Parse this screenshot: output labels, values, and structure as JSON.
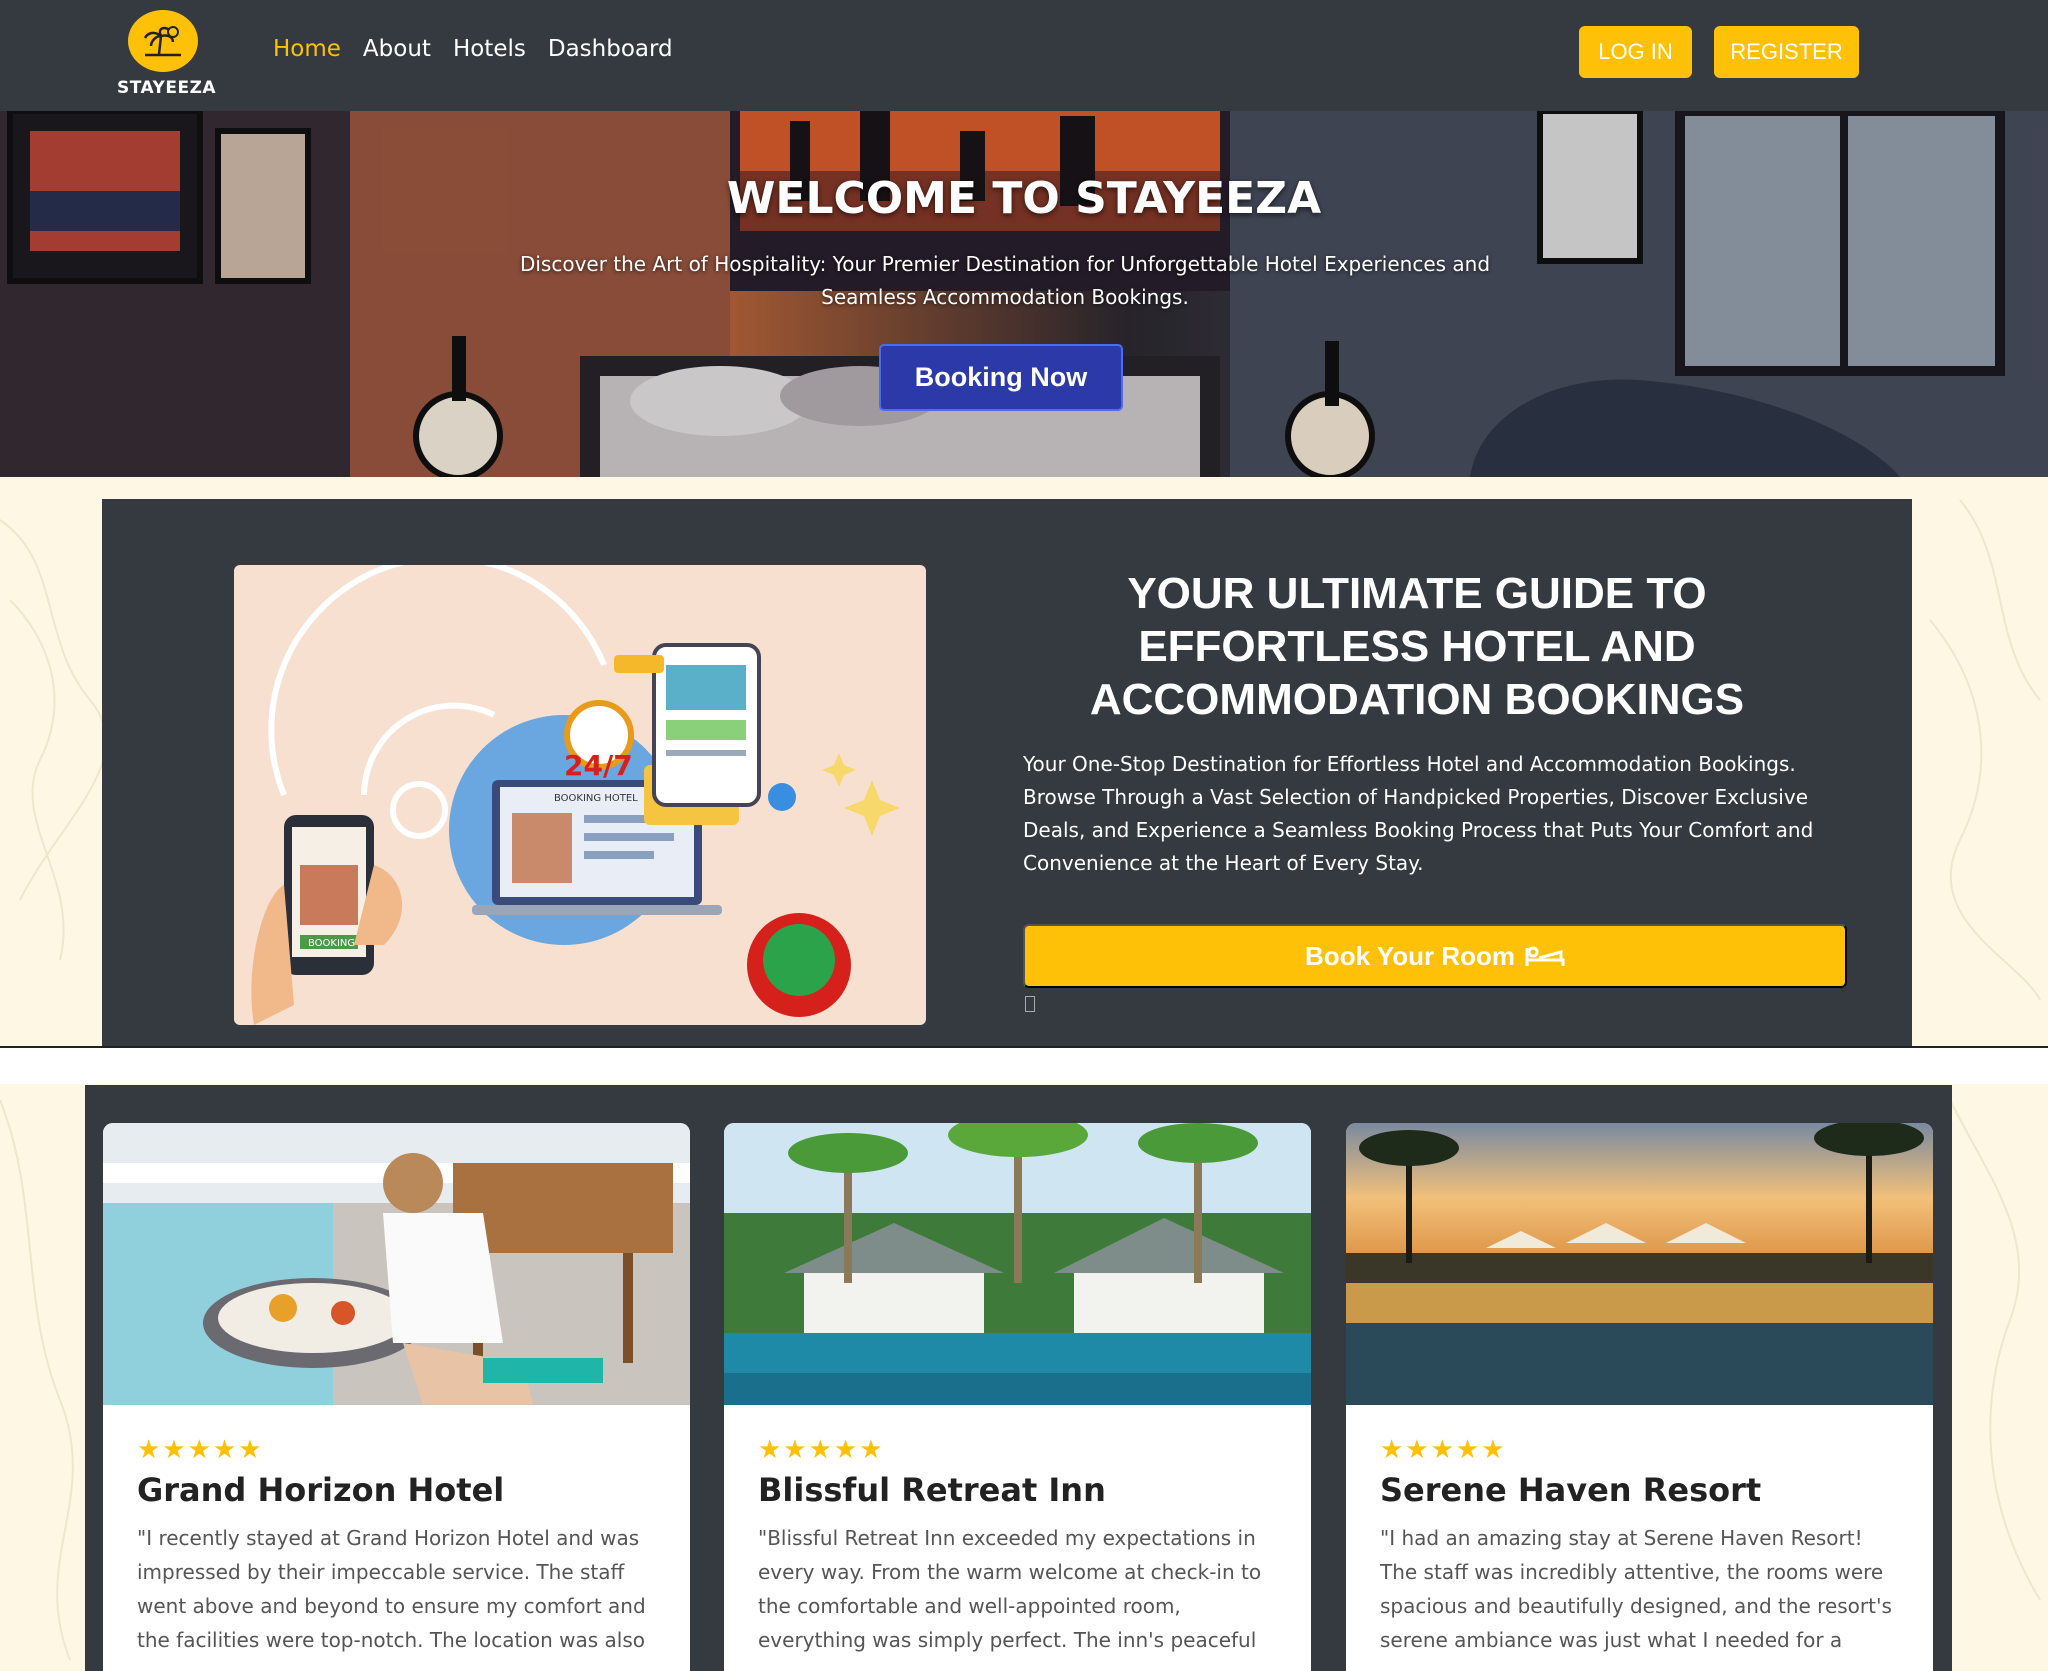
{
  "brand": {
    "name": "STAYEEZA"
  },
  "nav": {
    "links": [
      "Home",
      "About",
      "Hotels",
      "Dashboard"
    ],
    "login_label": "LOG IN",
    "register_label": "REGISTER"
  },
  "hero": {
    "title": "WELCOME TO STAYEEZA",
    "subtitle": "Discover the Art of Hospitality: Your Premier Destination for Unforgettable Hotel Experiences and Seamless Accommodation Bookings.",
    "button_label": "Booking Now"
  },
  "guide": {
    "illustration_labels": {
      "hours": "24/7",
      "screen": "BOOKING HOTEL",
      "phone": "BOOKING"
    },
    "title": "YOUR ULTIMATE GUIDE TO EFFORTLESS HOTEL AND ACCOMMODATION BOOKINGS",
    "text": "Your One-Stop Destination for Effortless Hotel and Accommodation Bookings. Browse Through a Vast Selection of Handpicked Properties, Discover Exclusive Deals, and Experience a Seamless Booking Process that Puts Your Comfort and Convenience at the Heart of Every Stay.",
    "button_label": "Book Your Room"
  },
  "hotels": [
    {
      "rating": 5,
      "stars": "★★★★★",
      "name": "Grand Horizon Hotel",
      "review": "\"I recently stayed at Grand Horizon Hotel and was impressed by their impeccable service. The staff went above and beyond to ensure my comfort and the facilities were top-notch. The location was also"
    },
    {
      "rating": 5,
      "stars": "★★★★★",
      "name": "Blissful Retreat Inn",
      "review": "\"Blissful Retreat Inn exceeded my expectations in every way. From the warm welcome at check-in to the comfortable and well-appointed room, everything was simply perfect. The inn's peaceful"
    },
    {
      "rating": 5,
      "stars": "★★★★★",
      "name": "Serene Haven Resort",
      "review": "\"I had an amazing stay at Serene Haven Resort! The staff was incredibly attentive, the rooms were spacious and beautifully designed, and the resort's serene ambiance was just what I needed for a"
    }
  ],
  "colors": {
    "accent": "#ffc107",
    "dark": "#343a40",
    "hero_button": "#2b3aa8"
  }
}
